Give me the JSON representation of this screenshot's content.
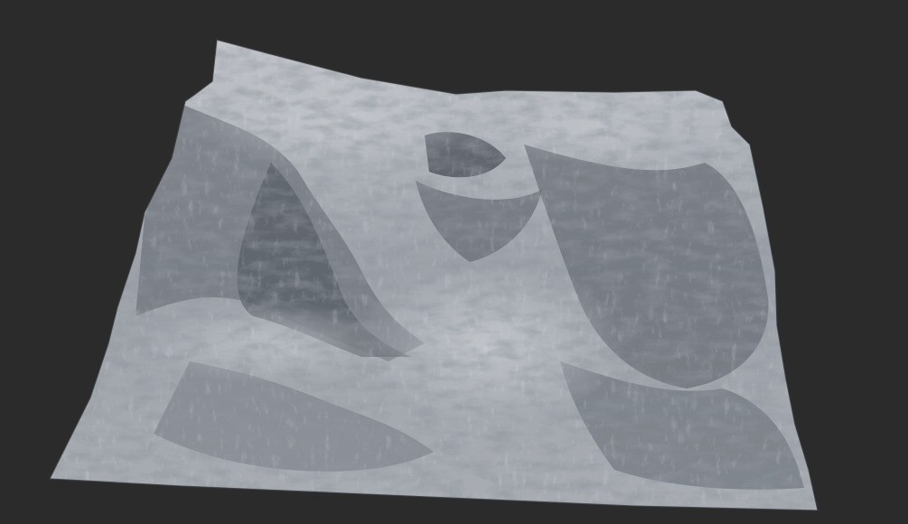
{
  "scene": {
    "background_color": "#2b2b2b",
    "subject": "3d-terrain-heightmap-render",
    "material": "untextured-grey-clay",
    "terrain_color_light": "#c9ccd1",
    "terrain_color_mid": "#8e939b",
    "terrain_color_dark": "#4a4f57"
  }
}
